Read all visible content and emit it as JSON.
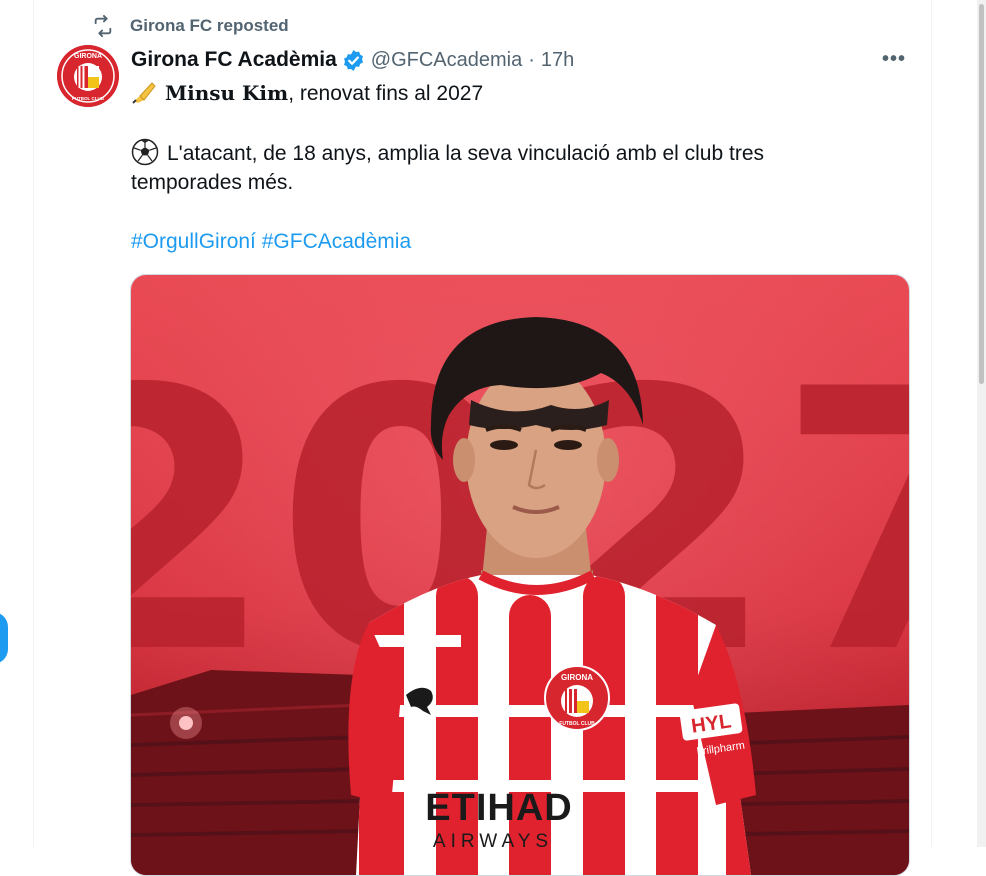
{
  "repost": {
    "label": "Girona FC reposted",
    "icon": "repost-icon"
  },
  "author": {
    "display_name": "Girona FC Acadèmia",
    "handle": "@GFCAcademia",
    "separator": "·",
    "time": "17h",
    "verified": true,
    "avatar_text_top": "GIRONA",
    "avatar_text_bottom": "FUTBOL CLUB"
  },
  "tweet": {
    "line1_name": "𝐌𝐢𝐧𝐬𝐮 𝐊𝐢𝐦",
    "line1_rest": ", renovat fins al 2027",
    "line2": "L'atacant, de 18 anys, amplia la seva vinculació amb el club tres",
    "line3": "temporades més.",
    "hashtags": [
      "#OrgullGironí",
      "#GFCAcadèmia"
    ]
  },
  "media": {
    "big_year": "2027",
    "shirt_sponsor": "ETIHAD",
    "shirt_sponsor_sub": "AIRWAYS",
    "sleeve_sponsor": "HYL",
    "sleeve_sponsor_sub": "brillpharm",
    "crest_text": "GIRONA",
    "crest_sub": "FUTBOL CLUB"
  },
  "colors": {
    "accent": "#1d9bf0",
    "brand_red": "#d8262e",
    "secondary_text": "#536471"
  }
}
